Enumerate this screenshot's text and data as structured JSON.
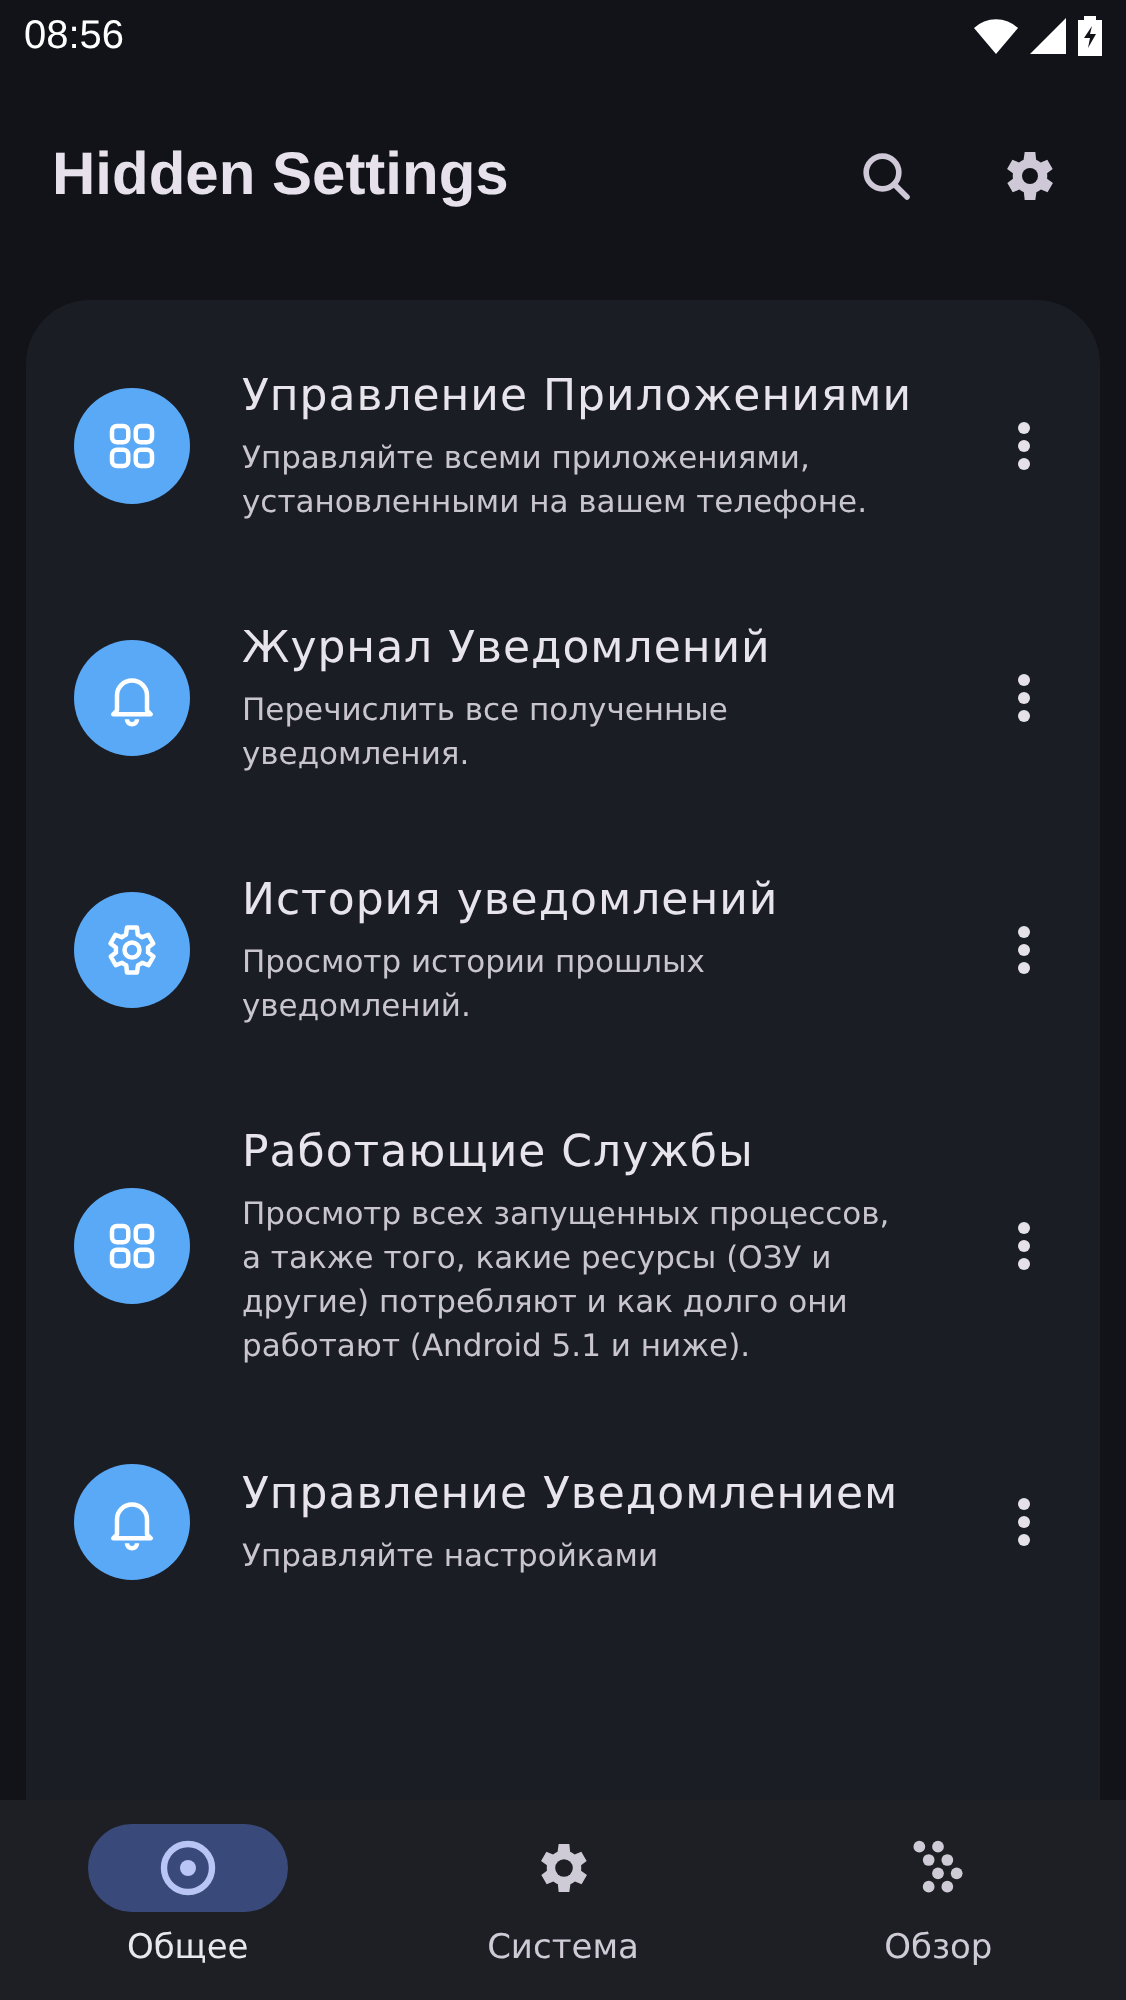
{
  "status_bar": {
    "time": "08:56"
  },
  "app_bar": {
    "title": "Hidden Settings"
  },
  "items": [
    {
      "kind": "grid",
      "title": "Управление Приложениями",
      "description": "Управляйте всеми приложениями, установленными на вашем телефоне."
    },
    {
      "kind": "bell",
      "title": "Журнал Уведомлений",
      "description": "Перечислить все полученные уведомления."
    },
    {
      "kind": "gear",
      "title": "История уведомлений",
      "description": "Просмотр истории прошлых уведомлений."
    },
    {
      "kind": "grid",
      "title": "Работающие Службы",
      "description": "Просмотр всех запущенных процессов, а также того, какие ресурсы (ОЗУ и другие) потребляют и как долго они работают (Android 5.1 и ниже)."
    },
    {
      "kind": "bell",
      "title": "Управление Уведомлением",
      "description": "Управляйте настройками"
    }
  ],
  "bottom_nav": [
    {
      "kind": "target",
      "label": "Общее",
      "selected": true
    },
    {
      "kind": "gear",
      "label": "Система",
      "selected": false
    },
    {
      "kind": "dots",
      "label": "Обзор",
      "selected": false
    }
  ]
}
